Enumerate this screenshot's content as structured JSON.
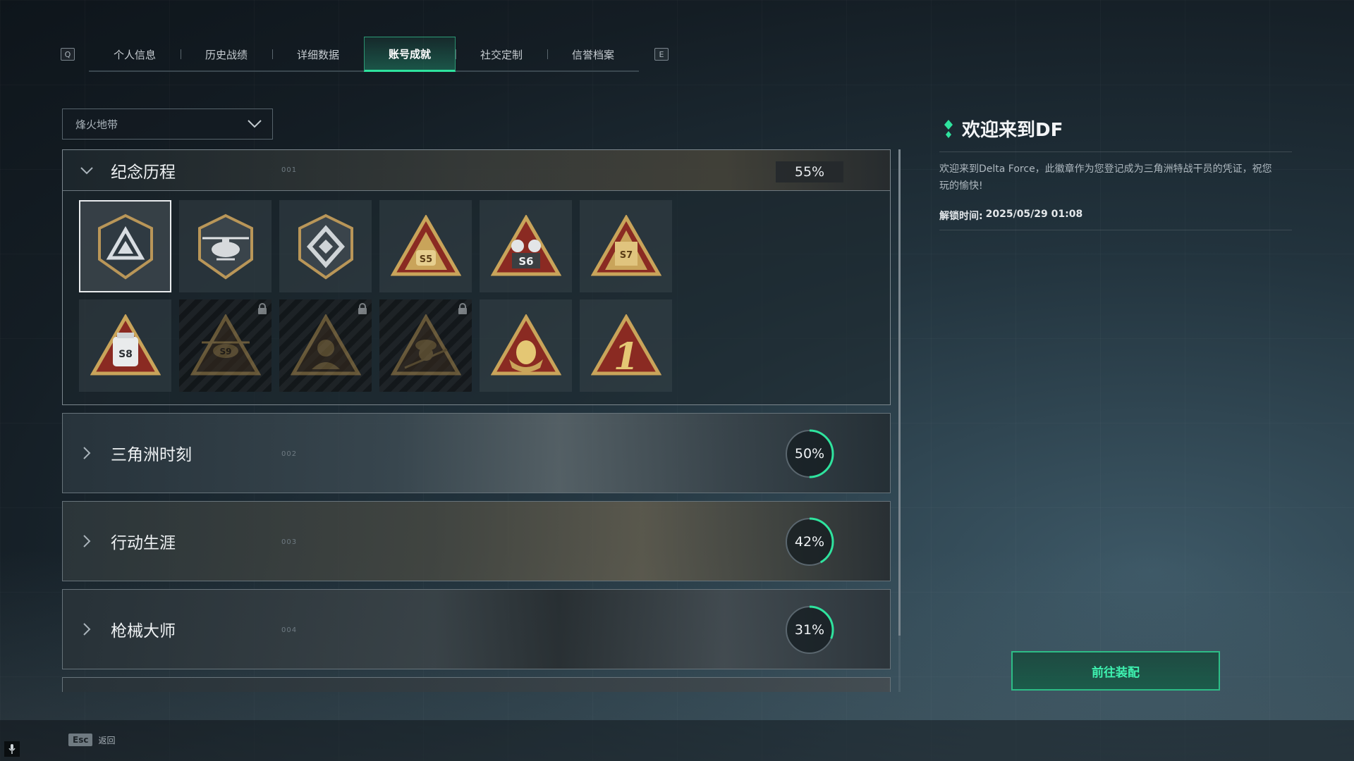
{
  "tabs": {
    "left_key": "Q",
    "right_key": "E",
    "items": [
      {
        "label": "个人信息"
      },
      {
        "label": "历史战绩"
      },
      {
        "label": "详细数据"
      },
      {
        "label": "账号成就"
      },
      {
        "label": "社交定制"
      },
      {
        "label": "信誉档案"
      }
    ],
    "active_index": 3
  },
  "mode_dropdown": {
    "value": "烽火地带"
  },
  "categories": {
    "commemorative": {
      "title": "纪念历程",
      "code": "001",
      "percent_label": "55%",
      "percent": 55,
      "badges": [
        {
          "icon": "shield-triangle-badge-icon",
          "locked": false,
          "selected": true
        },
        {
          "icon": "helicopter-shield-badge-icon",
          "locked": false
        },
        {
          "icon": "diamond-shield-badge-icon",
          "locked": false
        },
        {
          "icon": "season-s5-badge-icon",
          "label": "S5",
          "locked": false
        },
        {
          "icon": "season-s6-badge-icon",
          "label": "S6",
          "locked": false
        },
        {
          "icon": "season-s7-badge-icon",
          "label": "S7",
          "locked": false
        },
        {
          "icon": "season-s8-badge-icon",
          "label": "S8",
          "locked": false
        },
        {
          "icon": "season-s9-badge-icon",
          "label": "S9",
          "locked": true
        },
        {
          "icon": "operator-portrait-badge-icon",
          "locked": true
        },
        {
          "icon": "soldier-portrait-badge-icon",
          "locked": true
        },
        {
          "icon": "golden-egg-badge-icon",
          "locked": false
        },
        {
          "icon": "number-one-badge-icon",
          "label": "1",
          "locked": false
        }
      ]
    },
    "moments": {
      "title": "三角洲时刻",
      "code": "002",
      "percent_label": "50%",
      "percent": 50
    },
    "career": {
      "title": "行动生涯",
      "code": "003",
      "percent_label": "42%",
      "percent": 42
    },
    "weapons": {
      "title": "枪械大师",
      "code": "004",
      "percent_label": "31%",
      "percent": 31
    }
  },
  "detail": {
    "title": "欢迎来到DF",
    "description": "欢迎来到Delta Force，此徽章作为您登记成为三角洲特战干员的凭证，祝您玩的愉快!",
    "unlock_label": "解锁时间:",
    "unlock_time": "2025/05/29 01:08"
  },
  "equip_button": {
    "label": "前往装配"
  },
  "esc": {
    "key": "Esc",
    "label": "返回"
  },
  "colors": {
    "accent": "#2fe39e",
    "ring_track": "#5a666e",
    "badge_gold": "#c9a45a",
    "badge_red": "#8a2a22"
  }
}
